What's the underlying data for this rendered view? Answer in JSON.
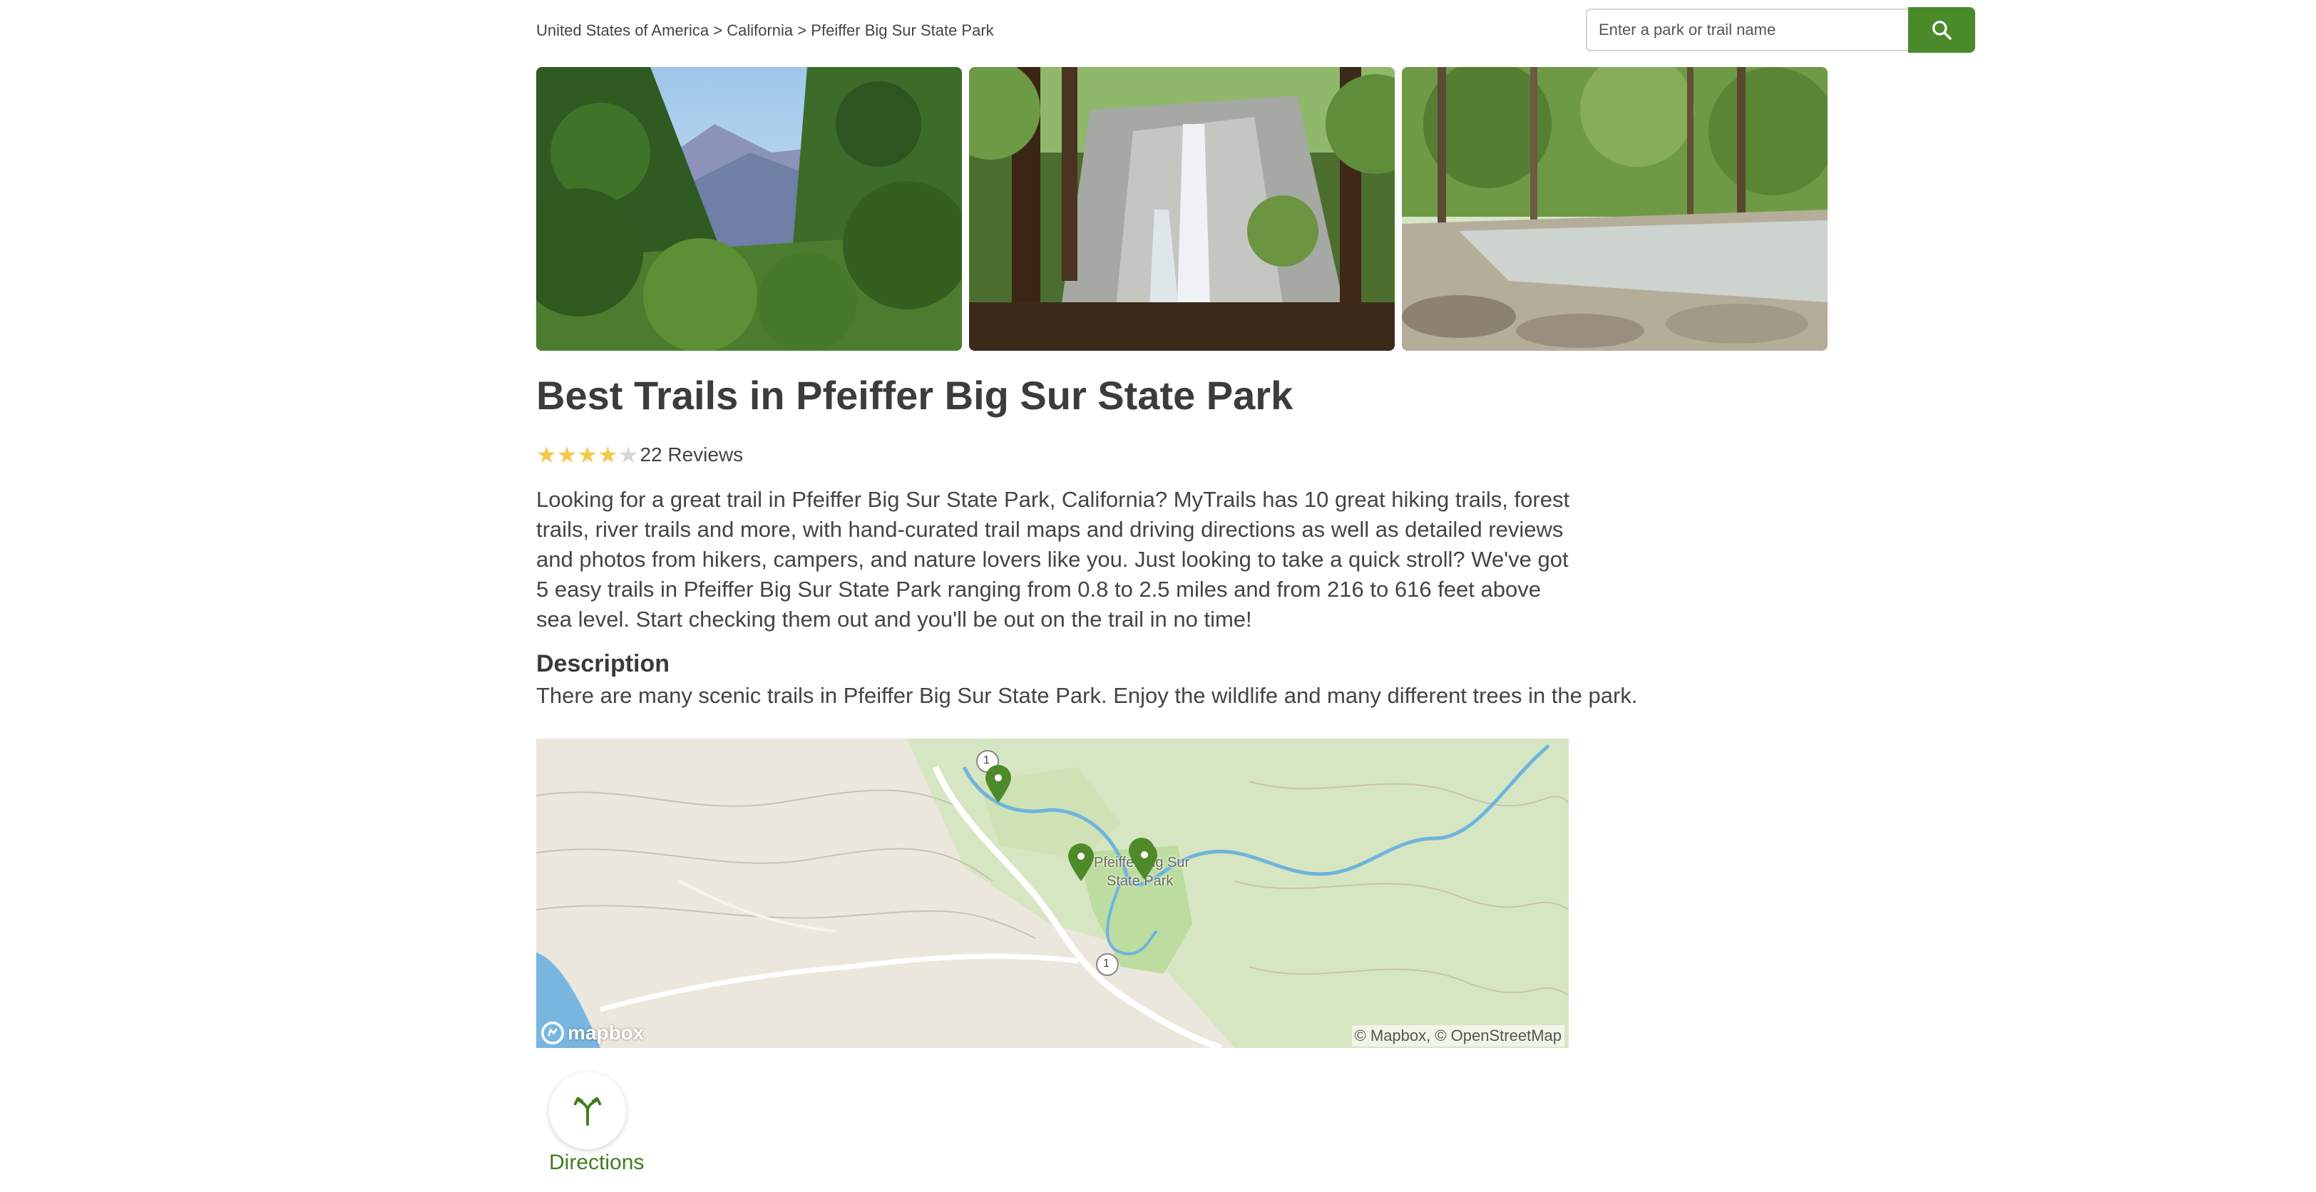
{
  "breadcrumb": {
    "items": [
      "United States of America",
      "California",
      "Pfeiffer Big Sur State Park"
    ],
    "separator": ">"
  },
  "search": {
    "placeholder": "Enter a park or trail name",
    "value": "",
    "button_icon": "search-icon"
  },
  "gallery": {
    "photos": [
      "mountain-valley-photo",
      "waterfall-photo",
      "river-forest-photo"
    ]
  },
  "page_title": "Best Trails in Pfeiffer Big Sur State Park",
  "rating": {
    "stars": 4,
    "max_stars": 5,
    "reviews_label": "22 Reviews"
  },
  "intro": "Looking for a great trail in Pfeiffer Big Sur State Park, California? MyTrails has 10 great hiking trails, forest trails, river trails and more, with hand-curated trail maps and driving directions as well as detailed reviews and photos from hikers, campers, and nature lovers like you. Just looking to take a quick stroll? We've got 5 easy trails in Pfeiffer Big Sur State Park ranging from 0.8 to 2.5 miles and from 216 to 616 feet above sea level. Start checking them out and you'll be out on the trail in no time!",
  "description": {
    "heading": "Description",
    "text": "There are many scenic trails in Pfeiffer Big Sur State Park. Enjoy the wildlife and many different trees in the park."
  },
  "map": {
    "park_label_line1": "Pfeiffer Big Sur",
    "park_label_line2": "State Park",
    "route_label": "1",
    "attribution": "© Mapbox, © OpenStreetMap",
    "logo": "mapbox",
    "pin_color": "#4f8a2a"
  },
  "directions": {
    "label": "Directions",
    "icon": "directions-icon"
  },
  "colors": {
    "accent": "#4a8a2a",
    "star": "#f2c94c",
    "link": "#3f7d1e"
  }
}
